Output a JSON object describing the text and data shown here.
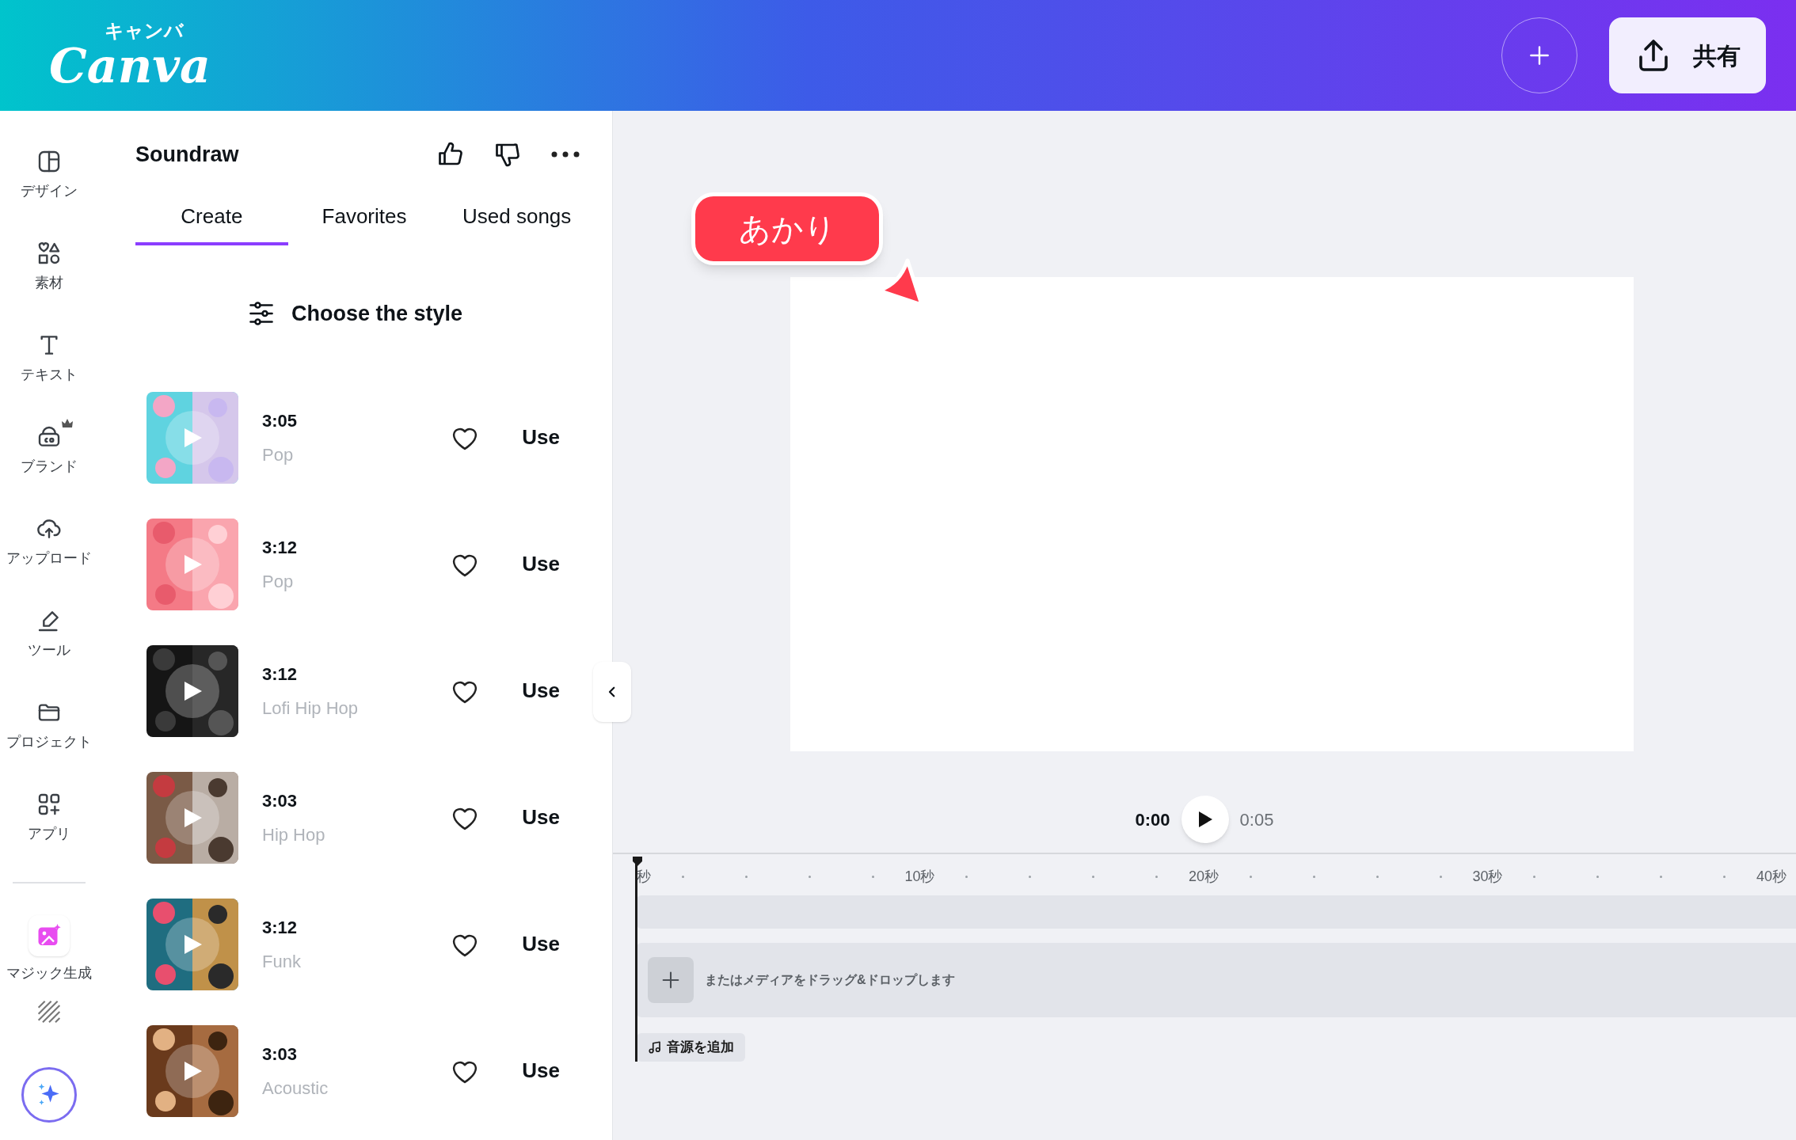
{
  "header": {
    "logo": "Canva",
    "logo_kana": "キャンバ",
    "share_button": "共有"
  },
  "rail": {
    "items": [
      {
        "label": "デザイン",
        "kind": "design"
      },
      {
        "label": "素材",
        "kind": "elements"
      },
      {
        "label": "テキスト",
        "kind": "text"
      },
      {
        "label": "ブランド",
        "kind": "brand"
      },
      {
        "label": "アップロード",
        "kind": "upload"
      },
      {
        "label": "ツール",
        "kind": "tools"
      },
      {
        "label": "プロジェクト",
        "kind": "projects"
      },
      {
        "label": "アプリ",
        "kind": "apps"
      },
      {
        "label": "マジック生成",
        "kind": "magic"
      }
    ]
  },
  "panel": {
    "title": "Soundraw",
    "tabs": [
      {
        "label": "Create",
        "selected": true
      },
      {
        "label": "Favorites",
        "selected": false
      },
      {
        "label": "Used songs",
        "selected": false
      }
    ],
    "style_button": "Choose the style",
    "songs": [
      {
        "duration": "3:05",
        "genre": "Pop",
        "favorite": false,
        "use": "Use"
      },
      {
        "duration": "3:12",
        "genre": "Pop",
        "favorite": false,
        "use": "Use"
      },
      {
        "duration": "3:12",
        "genre": "Lofi Hip Hop",
        "favorite": false,
        "use": "Use"
      },
      {
        "duration": "3:03",
        "genre": "Hip Hop",
        "favorite": false,
        "use": "Use"
      },
      {
        "duration": "3:12",
        "genre": "Funk",
        "favorite": false,
        "use": "Use"
      },
      {
        "duration": "3:03",
        "genre": "Acoustic",
        "favorite": false,
        "use": "Use"
      }
    ]
  },
  "canvas": {
    "sticker": "あかり"
  },
  "playback": {
    "current": "0:00",
    "total": "0:05"
  },
  "timeline": {
    "ticks": [
      "秒",
      "10秒",
      "20秒",
      "30秒",
      "40秒"
    ],
    "drop_hint": "またはメディアをドラッグ&ドロップします",
    "add_audio": "音源を追加"
  }
}
